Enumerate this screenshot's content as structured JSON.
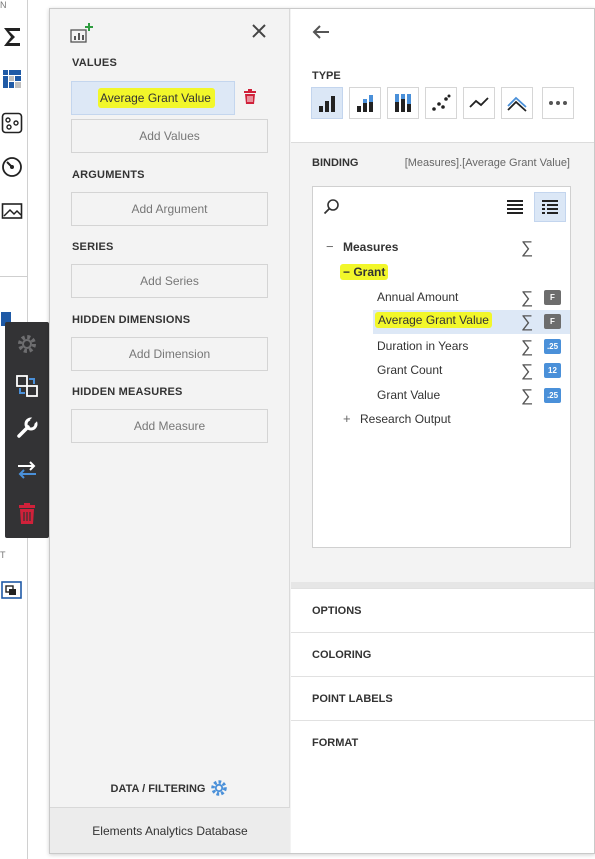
{
  "background_toolbox": {
    "top_fragment": "N",
    "bottom_fragment": "T",
    "icons": [
      "sum-icon",
      "pivot-icon",
      "scatter-map-icon",
      "gauge-icon",
      "image-icon",
      "layout-icon"
    ]
  },
  "item_toolbar": {
    "buttons": [
      "gear-icon",
      "convert-icon",
      "wrench-icon",
      "swap-icon",
      "delete-icon"
    ]
  },
  "left": {
    "sections": {
      "values": "VALUES",
      "arguments": "ARGUMENTS",
      "series": "SERIES",
      "hidden_dimensions": "HIDDEN DIMENSIONS",
      "hidden_measures": "HIDDEN MEASURES"
    },
    "value_item": "Average Grant Value",
    "add": {
      "values": "Add Values",
      "argument": "Add Argument",
      "series": "Add Series",
      "dimension": "Add Dimension",
      "measure": "Add Measure"
    },
    "data_filtering": "DATA / FILTERING",
    "datasource": "Elements Analytics Database"
  },
  "right": {
    "type_label": "TYPE",
    "types": [
      "bar",
      "stacked-bar",
      "full-stacked-bar",
      "point",
      "line",
      "stacked-line",
      "more"
    ],
    "binding_label": "BINDING",
    "binding_path": "[Measures].[Average Grant Value]",
    "tree": {
      "root": "Measures",
      "group": "Grant",
      "fields": [
        {
          "name": "Annual Amount",
          "badge": "F",
          "badge_color": "#6d6d6d"
        },
        {
          "name": "Average Grant Value",
          "badge": "F",
          "badge_color": "#6d6d6d",
          "selected": true
        },
        {
          "name": "Duration in Years",
          "badge": ".25",
          "badge_color": "#4a90d9"
        },
        {
          "name": "Grant Count",
          "badge": "12",
          "badge_color": "#4a90d9"
        },
        {
          "name": "Grant Value",
          "badge": ".25",
          "badge_color": "#4a90d9"
        }
      ],
      "collapsed": "Research Output"
    },
    "sections": [
      "OPTIONS",
      "COLORING",
      "POINT LABELS",
      "FORMAT"
    ]
  },
  "colors": {
    "highlight": "#f2f72a",
    "accent": "#1f5aa6",
    "selected_bg": "#dde8f6",
    "delete_red": "#d0213a",
    "toolbar_bg": "#333335"
  }
}
